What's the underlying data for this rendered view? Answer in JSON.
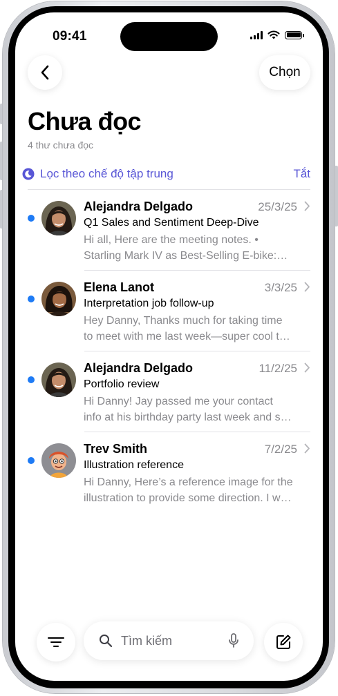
{
  "status_bar": {
    "time": "09:41"
  },
  "nav": {
    "back_icon": "chevron-left-icon",
    "select_label": "Chọn"
  },
  "header": {
    "title": "Chưa đọc",
    "subtitle": "4 thư chưa đọc"
  },
  "focus_filter": {
    "icon": "moon-icon",
    "label": "Lọc theo chế độ tập trung",
    "action_label": "Tắt",
    "accent": "#5856d6"
  },
  "mails": [
    {
      "sender": "Alejandra Delgado",
      "date": "25/3/25",
      "subject": "Q1 Sales and Sentiment Deep-Dive",
      "preview_line1": "Hi all, Here are the meeting notes. •",
      "preview_line2": "Starling Mark IV as Best-Selling E-bike:…",
      "unread": true
    },
    {
      "sender": "Elena Lanot",
      "date": "3/3/25",
      "subject": "Interpretation job follow-up",
      "preview_line1": "Hey Danny, Thanks much for taking time",
      "preview_line2": "to meet with me last week—super cool t…",
      "unread": true
    },
    {
      "sender": "Alejandra Delgado",
      "date": "11/2/25",
      "subject": "Portfolio review",
      "preview_line1": "Hi Danny! Jay passed me your contact",
      "preview_line2": "info at his birthday party last week and s…",
      "unread": true
    },
    {
      "sender": "Trev Smith",
      "date": "7/2/25",
      "subject": "Illustration reference",
      "preview_line1": "Hi Danny, Here’s a reference image for the",
      "preview_line2": "illustration to provide some direction. I w…",
      "unread": true
    }
  ],
  "toolbar": {
    "filter_icon": "filter-lines-icon",
    "search_placeholder": "Tìm kiếm",
    "mic_icon": "microphone-icon",
    "compose_icon": "compose-icon"
  },
  "colors": {
    "unread_dot": "#1e7bf5",
    "secondary_text": "#8a8a8e",
    "separator": "#e2e2e6"
  }
}
